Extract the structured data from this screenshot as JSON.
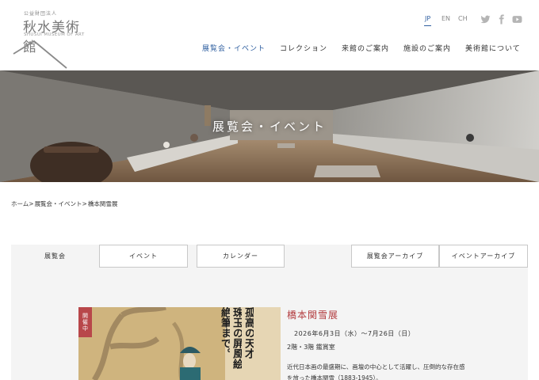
{
  "header": {
    "logo": {
      "kicker": "公益財団法人",
      "name": "秋水美術館",
      "sub": "SHUSUI MUSEUM OF ART"
    },
    "languages": [
      {
        "label": "JP",
        "active": true
      },
      {
        "label": "EN",
        "active": false
      },
      {
        "label": "CH",
        "active": false
      }
    ],
    "social_icons": [
      "twitter-icon",
      "facebook-icon",
      "youtube-icon"
    ],
    "nav": [
      {
        "label": "展覧会・イベント",
        "active": true
      },
      {
        "label": "コレクション",
        "active": false
      },
      {
        "label": "来館のご案内",
        "active": false
      },
      {
        "label": "施設のご案内",
        "active": false
      },
      {
        "label": "美術館について",
        "active": false
      }
    ],
    "accent_color": "#2f5fa0"
  },
  "hero": {
    "title": "展覧会・イベント"
  },
  "breadcrumb": [
    "ホーム>",
    "展覧会・イベント>",
    "橋本関雪展"
  ],
  "tabs": {
    "left": [
      {
        "label": "展覧会",
        "active": true
      },
      {
        "label": "イベント",
        "active": false
      },
      {
        "label": "カレンダー",
        "active": false
      }
    ],
    "right": [
      {
        "label": "展覧会アーカイブ",
        "active": false
      },
      {
        "label": "イベントアーカイブ",
        "active": false
      }
    ]
  },
  "exhibition": {
    "badge": "開催中",
    "poster_lines": [
      "孤高の天才",
      "珠玉の屏風絵",
      "絶筆まで。"
    ],
    "title": "橋本関雪展",
    "date": "2026年6月3日（水）〜7月26日（日）",
    "floor": "2階・3階 鑑賞室",
    "description": "近代日本画の最盛期に、画壇の中心として活躍し、圧倒的な存在感を放った橋本関雪（1883-1945）。",
    "title_color": "#b23a3d",
    "badge_color": "#b8474a"
  }
}
